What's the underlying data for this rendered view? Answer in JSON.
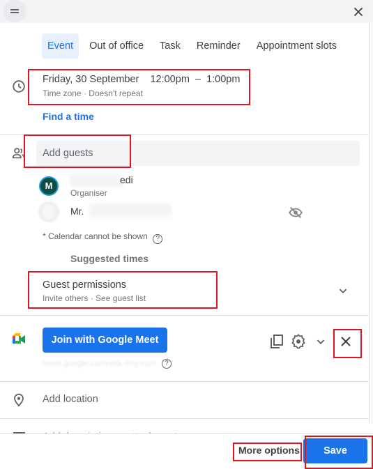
{
  "header": {
    "drag_handle_icon": "drag-handle-icon",
    "close_icon": "close-icon"
  },
  "tabs": [
    {
      "label": "Event",
      "active": true
    },
    {
      "label": "Out of office",
      "active": false
    },
    {
      "label": "Task",
      "active": false
    },
    {
      "label": "Reminder",
      "active": false
    },
    {
      "label": "Appointment slots",
      "active": false
    }
  ],
  "datetime": {
    "icon": "clock-icon",
    "main": "Friday, 30 September    12:00pm  –  1:00pm",
    "sub": "Time zone · Doesn't repeat",
    "find_time": "Find a time"
  },
  "guests": {
    "icon": "people-icon",
    "placeholder": "Add guests",
    "list": [
      {
        "avatar_letter": "M",
        "name": "edi",
        "role": "Organiser"
      },
      {
        "name": "Mr.",
        "visibility_icon": "eye-off-icon"
      }
    ],
    "calendar_note": "* Calendar cannot be shown",
    "help_glyph": "?",
    "suggested_times": "Suggested times"
  },
  "permissions": {
    "title": "Guest permissions",
    "sub": "Invite others · See guest list",
    "chevron": "chevron-down-icon"
  },
  "meet": {
    "icon": "google-meet-icon",
    "button_label": "Join with Google Meet",
    "link": "meet.google.com/ekk-thsj-ezm",
    "help_glyph": "?",
    "actions": [
      "copy-icon",
      "gear-icon",
      "chevron-down-icon",
      "close-icon"
    ]
  },
  "location": {
    "icon": "location-pin-icon",
    "placeholder": "Add location"
  },
  "description": {
    "icon": "description-icon",
    "placeholder": "Add description or attachments"
  },
  "footer": {
    "more_options": "More options",
    "save": "Save"
  },
  "colors": {
    "accent": "#1a73e8",
    "annotation_red": "#e0141e",
    "header_bg": "#f1f3f4"
  }
}
